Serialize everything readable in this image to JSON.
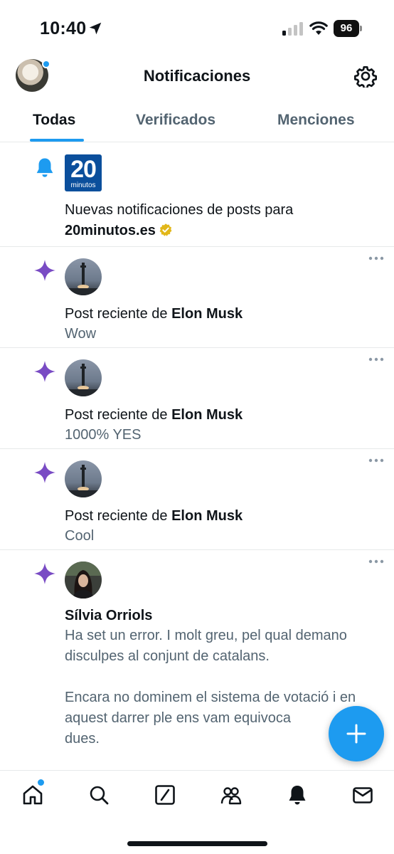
{
  "status_bar": {
    "time": "10:40",
    "battery": "96"
  },
  "header": {
    "title": "Notificaciones"
  },
  "tabs": [
    {
      "label": "Todas",
      "active": true
    },
    {
      "label": "Verificados",
      "active": false
    },
    {
      "label": "Menciones",
      "active": false
    }
  ],
  "notifications": [
    {
      "type": "new-posts",
      "icon": "bell-icon",
      "brand_logo": {
        "big": "20",
        "small": "minutos"
      },
      "text": "Nuevas notificaciones de posts para",
      "account": "20minutos.es"
    },
    {
      "type": "recent-post",
      "icon": "sparkle-icon",
      "prefix": "Post reciente de",
      "author": "Elon Musk",
      "preview": "Wow"
    },
    {
      "type": "recent-post",
      "icon": "sparkle-icon",
      "prefix": "Post reciente de",
      "author": "Elon Musk",
      "preview": "1000% YES"
    },
    {
      "type": "recent-post",
      "icon": "sparkle-icon",
      "prefix": "Post reciente de",
      "author": "Elon Musk",
      "preview": "Cool"
    },
    {
      "type": "post",
      "icon": "sparkle-icon",
      "author": "Sílvia Orriols",
      "text": "Ha set un error. I molt greu, pel qual demano disculpes al conjunt de catalans.\n\nEncara no dominem el sistema de votació i en aquest darrer ple ens vam equivoca\ndues."
    }
  ],
  "colors": {
    "accent": "#1d9bf0",
    "sparkle": "#794bc4",
    "text": "#0f1419",
    "muted": "#536471",
    "verified": "#e2b719"
  },
  "bottom_nav": [
    "home-icon",
    "search-icon",
    "grok-icon",
    "communities-icon",
    "notifications-icon",
    "messages-icon"
  ]
}
